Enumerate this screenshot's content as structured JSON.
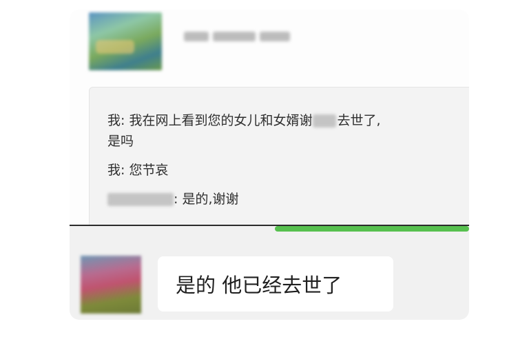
{
  "quote": {
    "line1": "我: 我在网上看到您的女儿和女婿谢",
    "line1_tail": "去世了,",
    "line1b": "是吗",
    "line2": "我: 您节哀",
    "line3_tail": ": 是的,谢谢"
  },
  "reply": {
    "text": "是的 他已经去世了"
  },
  "colors": {
    "accent": "#57c04f",
    "quote_bg": "#f3f3f3",
    "chat_bg": "#f1f1f1"
  }
}
